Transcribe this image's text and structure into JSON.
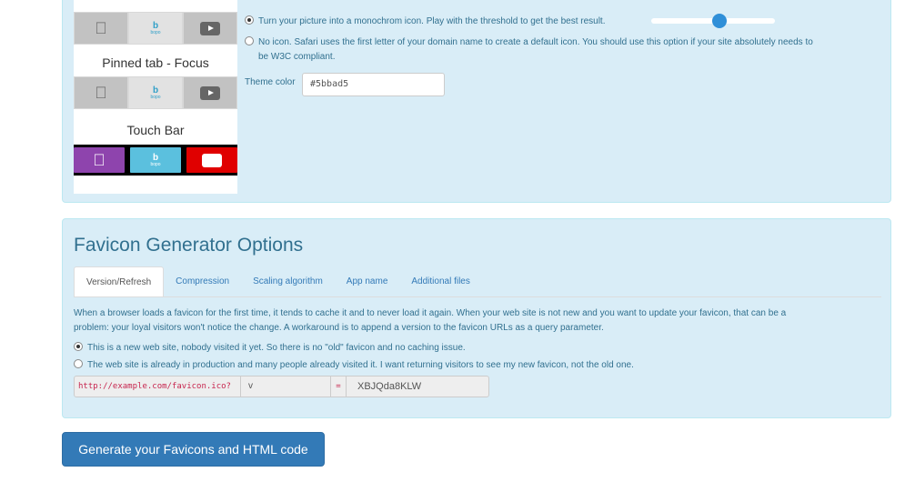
{
  "preview": {
    "pinned_caption": "Pinned tab - Focus",
    "touchbar_caption": "Touch Bar",
    "brand_letter": "b",
    "brand_sub": "bopo"
  },
  "silhouette": {
    "option_mono": "Turn your picture into a monochrom icon. Play with the threshold to get the best result.",
    "option_none": "No icon. Safari uses the first letter of your domain name to create a default icon. You should use this option if your site absolutely needs to",
    "option_none_cont": "be W3C compliant.",
    "theme_label": "Theme color",
    "theme_value": "#5bbad5",
    "threshold": 0.55
  },
  "options": {
    "title": "Favicon Generator Options",
    "tabs": [
      "Version/Refresh",
      "Compression",
      "Scaling algorithm",
      "App name",
      "Additional files"
    ],
    "para_1": "When a browser loads a favicon for the first time, it tends to cache it and to never load it again. When your web site is not new and you want to update your favicon, that can be a",
    "para_2": "problem: your loyal visitors won't notice the change. A workaround is to append a version to the favicon URLs as a query parameter.",
    "radio_new": "This is a new web site, nobody visited it yet. So there is no \"old\" favicon and no caching issue.",
    "radio_prod": "The web site is already in production and many people already visited it. I want returning visitors to see my new favicon, not the old one.",
    "url_prefix": "http://example.com/favicon.ico?",
    "param_name": "v",
    "equals": "=",
    "version_code": "XBJQda8KLW"
  },
  "generate_button": "Generate your Favicons and HTML code",
  "colors": {
    "panel_bg": "#d9edf7",
    "text": "#31708f",
    "primary": "#337ab7",
    "touchbar_purple": "#8e44ad",
    "touchbar_blue": "#5bc0de",
    "touchbar_red": "#e00000"
  }
}
